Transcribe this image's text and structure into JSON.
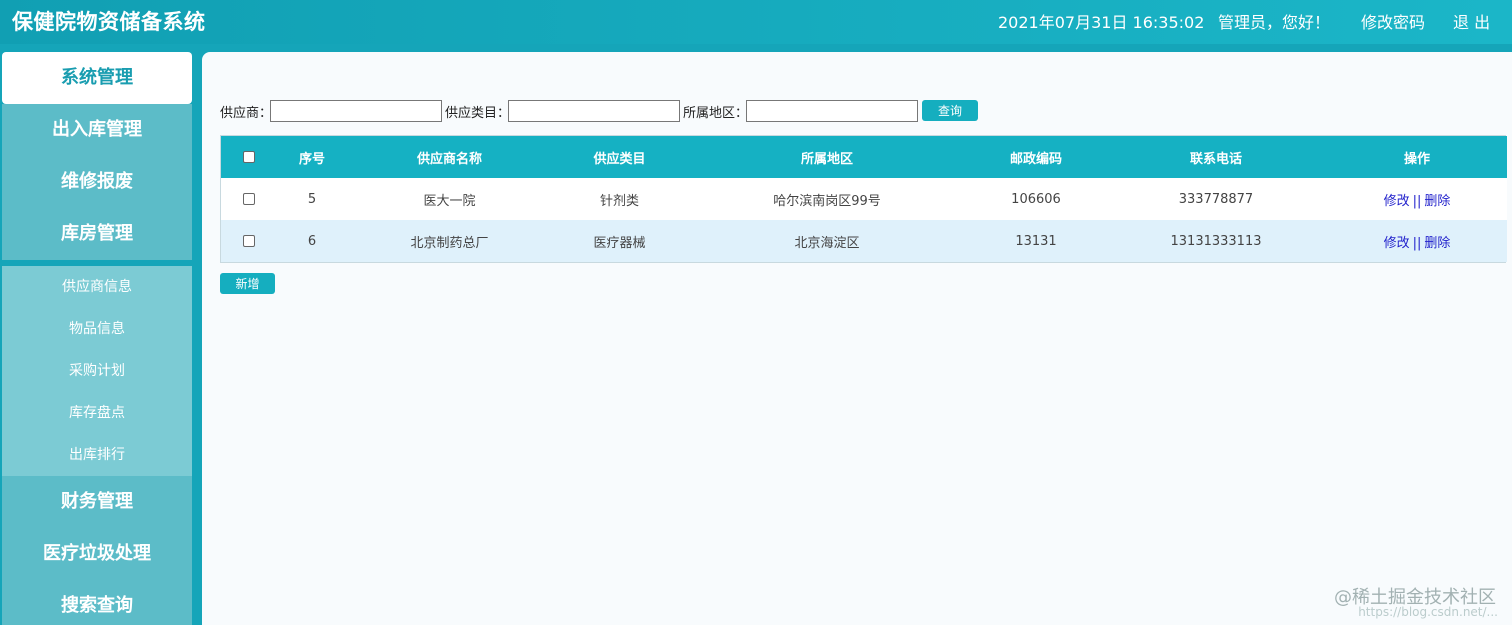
{
  "header": {
    "title": "保健院物资储备系统",
    "datetime": "2021年07月31日 16:35:02",
    "greeting": "管理员，您好！",
    "change_password": "修改密码",
    "logout": "退 出"
  },
  "sidebar": {
    "menus": [
      {
        "label": "系统管理",
        "active": true
      },
      {
        "label": "出入库管理",
        "active": false
      },
      {
        "label": "维修报废",
        "active": false
      },
      {
        "label": "库房管理",
        "active": false
      }
    ],
    "submenu": [
      {
        "label": "供应商信息"
      },
      {
        "label": "物品信息"
      },
      {
        "label": "采购计划"
      },
      {
        "label": "库存盘点"
      },
      {
        "label": "出库排行"
      }
    ],
    "menus_bottom": [
      {
        "label": "财务管理"
      },
      {
        "label": "医疗垃圾处理"
      },
      {
        "label": "搜索查询"
      }
    ]
  },
  "filter": {
    "supplier_label": "供应商：",
    "category_label": "供应类目：",
    "region_label": "所属地区：",
    "supplier_value": "",
    "category_value": "",
    "region_value": "",
    "search_button": "查询"
  },
  "table": {
    "columns": [
      "序号",
      "供应商名称",
      "供应类目",
      "所属地区",
      "邮政编码",
      "联系电话",
      "操作"
    ],
    "rows": [
      {
        "id": "5",
        "name": "医大一院",
        "category": "针剂类",
        "region": "哈尔滨南岗区99号",
        "postcode": "106606",
        "phone": "333778877",
        "edit": "修改",
        "sep": "||",
        "delete": "删除"
      },
      {
        "id": "6",
        "name": "北京制药总厂",
        "category": "医疗器械",
        "region": "北京海淀区",
        "postcode": "13131",
        "phone": "13131333113",
        "edit": "修改",
        "sep": "||",
        "delete": "删除"
      }
    ]
  },
  "add_button": "新增",
  "watermark": {
    "main": "@稀土掘金技术社区",
    "sub": "https://blog.csdn.net/..."
  },
  "colors": {
    "primary": "#15a5b9",
    "header_bg": "#15b1c3",
    "link": "#2222cc"
  }
}
